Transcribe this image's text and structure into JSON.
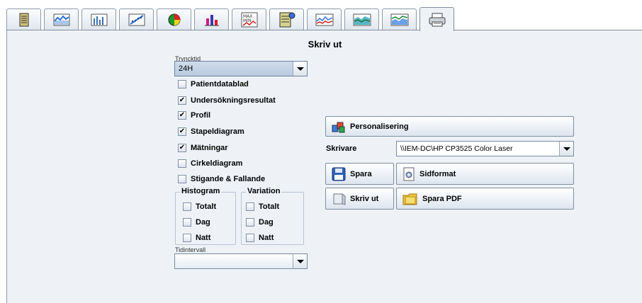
{
  "tabs": [
    {
      "icon": "patient-data-icon"
    },
    {
      "icon": "profile-icon"
    },
    {
      "icon": "bar-chart-icon"
    },
    {
      "icon": "scatter-icon"
    },
    {
      "icon": "pie-chart-icon"
    },
    {
      "icon": "stacked-bar-icon"
    },
    {
      "icon": "max-min-icon"
    },
    {
      "icon": "document-stats-icon"
    },
    {
      "icon": "line-chart-icon"
    },
    {
      "icon": "area-chart-icon"
    },
    {
      "icon": "compare-chart-icon"
    },
    {
      "icon": "printer-icon"
    }
  ],
  "active_tab": 11,
  "panel": {
    "title": "Skriv ut",
    "print_time_label": "Tryncktid",
    "print_time_value": "24H",
    "checkboxes": {
      "patient": {
        "label": "Patientdatablad",
        "checked": false
      },
      "results": {
        "label": "Undersökningsresultat",
        "checked": true
      },
      "profile": {
        "label": "Profil",
        "checked": true
      },
      "bar": {
        "label": "Stapeldiagram",
        "checked": true
      },
      "measurements": {
        "label": "Mätningar",
        "checked": true
      },
      "pie": {
        "label": "Cirkeldiagram",
        "checked": false
      },
      "rising": {
        "label": "Stigande & Fallande",
        "checked": false
      }
    },
    "histogram": {
      "title": "Histogram",
      "total": {
        "label": "Totalt",
        "checked": false
      },
      "day": {
        "label": "Dag",
        "checked": false
      },
      "night": {
        "label": "Natt",
        "checked": false
      }
    },
    "variation": {
      "title": "Variation",
      "total": {
        "label": "Totalt",
        "checked": false
      },
      "day": {
        "label": "Dag",
        "checked": false
      },
      "night": {
        "label": "Natt",
        "checked": false
      }
    },
    "interval_label": "Tidintervall",
    "interval_value": "",
    "personalize_label": "Personalisering",
    "printer_label": "Skrivare",
    "printer_value": "\\\\IEM-DC\\HP CP3525 Color Laser",
    "save_label": "Spara",
    "page_format_label": "Sidformat",
    "print_label": "Skriv ut",
    "save_pdf_label": "Spara PDF"
  }
}
